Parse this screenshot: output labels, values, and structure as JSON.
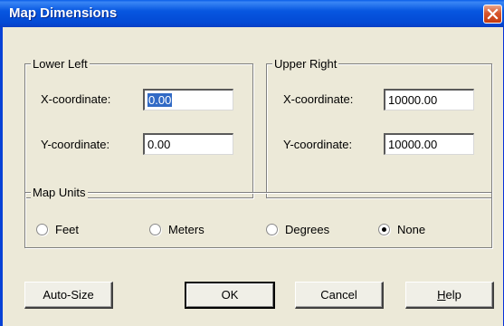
{
  "window": {
    "title": "Map Dimensions"
  },
  "lower_left": {
    "group_label": "Lower Left",
    "x_label": "X-coordinate:",
    "x_value": "0.00",
    "y_label": "Y-coordinate:",
    "y_value": "0.00"
  },
  "upper_right": {
    "group_label": "Upper Right",
    "x_label": "X-coordinate:",
    "x_value": "10000.00",
    "y_label": "Y-coordinate:",
    "y_value": "10000.00"
  },
  "map_units": {
    "group_label": "Map Units",
    "options": [
      {
        "label": "Feet",
        "selected": false
      },
      {
        "label": "Meters",
        "selected": false
      },
      {
        "label": "Degrees",
        "selected": false
      },
      {
        "label": "None",
        "selected": true
      }
    ]
  },
  "buttons": {
    "autosize": "Auto-Size",
    "ok": "OK",
    "cancel": "Cancel",
    "help_prefix": "",
    "help_mnemonic": "H",
    "help_rest": "elp"
  },
  "colors": {
    "titlebar": "#0757e0",
    "dialog_bg": "#ece9d8",
    "selection": "#316ac5"
  },
  "icons": {
    "close": "close-icon",
    "radio": "radio-icon"
  }
}
